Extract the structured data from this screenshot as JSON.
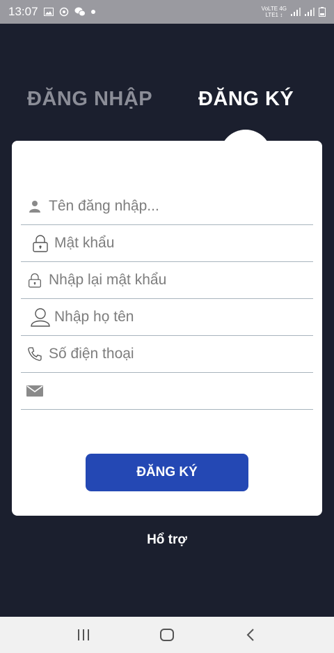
{
  "status_bar": {
    "time": "13:07",
    "icons": [
      "gallery-icon",
      "sync-icon",
      "chat-icon",
      "dot-icon"
    ],
    "network_top": "VoLTE 4G",
    "network_bottom": "LTE1 ↕",
    "signal_icons": [
      "signal-1-icon",
      "signal-2-icon",
      "battery-icon"
    ]
  },
  "tabs": {
    "login_label": "ĐĂNG NHẬP",
    "register_label": "ĐĂNG KÝ",
    "active": "register"
  },
  "form": {
    "username": {
      "placeholder": "Tên đăng nhập...",
      "value": "",
      "icon": "user-solid-icon"
    },
    "password": {
      "placeholder": "Mật khẩu",
      "value": "",
      "icon": "lock-icon"
    },
    "confirm_password": {
      "placeholder": "Nhập lại mật khẩu",
      "value": "",
      "icon": "lock-icon"
    },
    "full_name": {
      "placeholder": "Nhập họ tên",
      "value": "",
      "icon": "user-outline-icon"
    },
    "phone": {
      "placeholder": "Số điện thoại",
      "value": "",
      "icon": "phone-icon"
    },
    "email": {
      "placeholder": "",
      "value": "",
      "icon": "envelope-icon"
    },
    "submit_label": "ĐĂNG KÝ"
  },
  "support_label": "Hổ trợ",
  "nav_bar": {
    "icons": [
      "recent-apps-icon",
      "home-icon",
      "back-icon"
    ]
  },
  "colors": {
    "background": "#1b1f2e",
    "accent": "#2448b4",
    "card": "#ffffff",
    "inactive_tab": "#8b8d97"
  }
}
